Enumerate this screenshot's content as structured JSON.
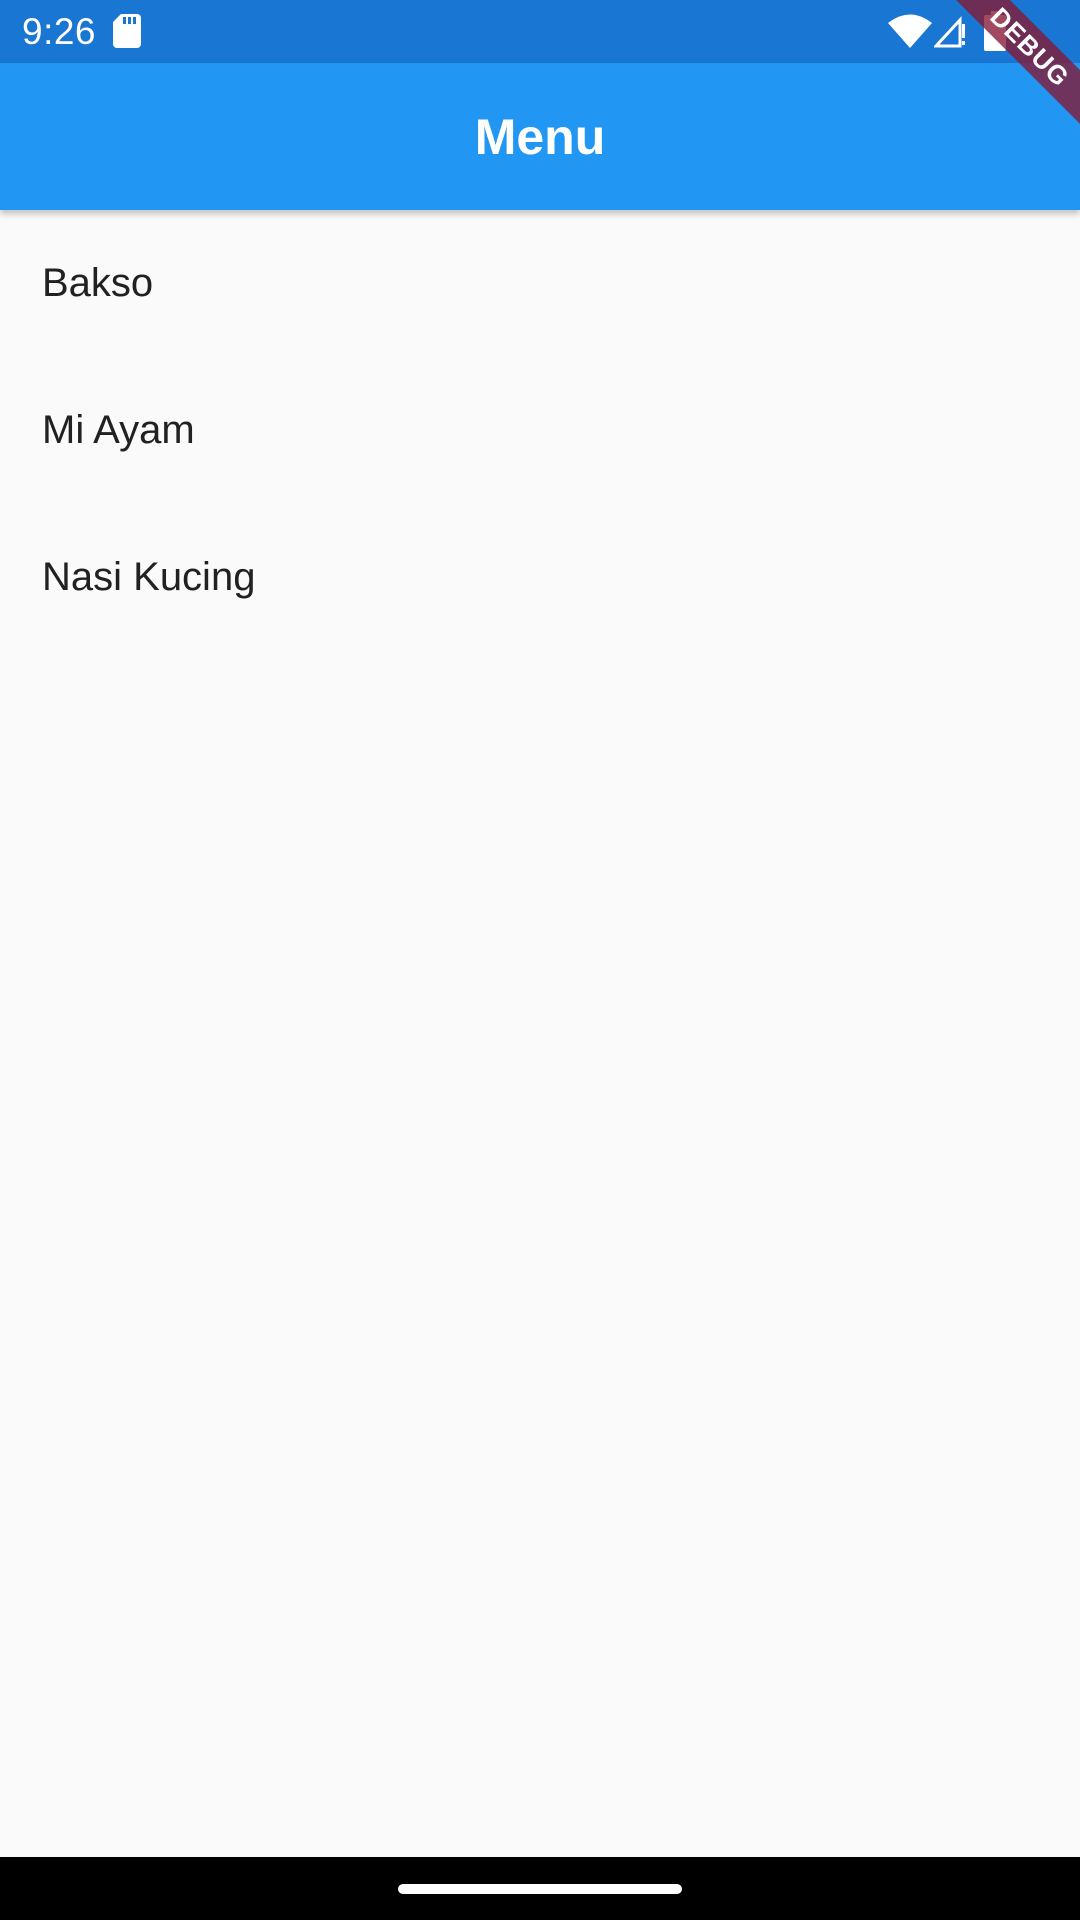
{
  "status_bar": {
    "time": "9:26",
    "icons": [
      "sd-card-icon",
      "wifi-icon",
      "signal-icon",
      "battery-icon"
    ],
    "background": "#1976d2"
  },
  "app_bar": {
    "title": "Menu",
    "background": "#2196f3"
  },
  "menu": {
    "items": [
      {
        "label": "Bakso"
      },
      {
        "label": "Mi Ayam"
      },
      {
        "label": "Nasi Kucing"
      }
    ]
  },
  "debug_banner": {
    "label": "DEBUG"
  },
  "nav_bar": {
    "indicator": "home-indicator"
  }
}
